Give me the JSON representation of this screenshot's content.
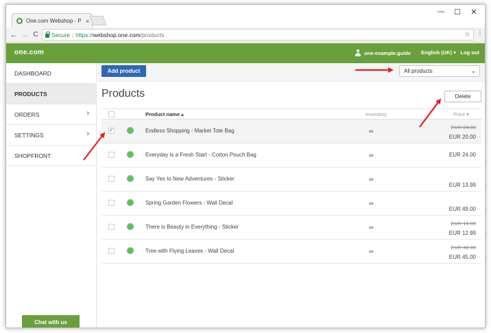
{
  "browser": {
    "tab_title": "One.com Webshop - Pro",
    "tab_close": "×",
    "window_controls": {
      "minimize": "—",
      "maximize": "☐",
      "close": "✕"
    },
    "nav": {
      "back": "←",
      "forward": "→",
      "reload": "C"
    },
    "security_label": "Secure",
    "url_scheme": "https://",
    "url_host": "webshop.one.com",
    "url_path": "/products",
    "bookmark_icon": "star-icon",
    "menu_icon": "⋮"
  },
  "header": {
    "logo": "one.com",
    "user": "one-example.guide",
    "language": "English (UK) ▾",
    "logout": "Log out",
    "brand_color": "#6aa03c"
  },
  "sidebar": {
    "items": [
      {
        "label": "DASHBOARD",
        "active": false,
        "chevron": false
      },
      {
        "label": "PRODUCTS",
        "active": true,
        "chevron": false
      },
      {
        "label": "ORDERS",
        "active": false,
        "chevron": true
      },
      {
        "label": "SETTINGS",
        "active": false,
        "chevron": true
      },
      {
        "label": "SHOPFRONT",
        "active": false,
        "chevron": false
      }
    ],
    "chat_label": "Chat with us"
  },
  "main": {
    "add_label": "Add product",
    "filter_value": "All products",
    "title": "Products",
    "delete_label": "Delete",
    "columns": {
      "name": "Product name ▴",
      "inventory": "Inventory",
      "price": "Price ▾"
    },
    "rows": [
      {
        "name": "Endless Shopping - Market Tote Bag",
        "inventory": "∞",
        "old_price": "EUR 24.00",
        "price": "EUR 20.00",
        "checked": true,
        "status_color": "#5cc45c"
      },
      {
        "name": "Everyday is a Fresh Start - Cotton Pouch Bag",
        "inventory": "∞",
        "old_price": "",
        "price": "EUR 24.00",
        "checked": false,
        "status_color": "#5cc45c"
      },
      {
        "name": "Say Yes to New Adventures - Sticker",
        "inventory": "∞",
        "old_price": "",
        "price": "EUR 13.99",
        "checked": false,
        "status_color": "#5cc45c"
      },
      {
        "name": "Spring Garden Flowers - Wall Decal",
        "inventory": "∞",
        "old_price": "",
        "price": "EUR 49.00",
        "checked": false,
        "status_color": "#5cc45c"
      },
      {
        "name": "There is Beauty in Everything - Sticker",
        "inventory": "∞",
        "old_price": "EUR 15.00",
        "price": "EUR 12.99",
        "checked": false,
        "status_color": "#5cc45c"
      },
      {
        "name": "Tree with Flying Leaves - Wall Decal",
        "inventory": "∞",
        "old_price": "EUR 49.00",
        "price": "EUR 45.00",
        "checked": false,
        "status_color": "#5cc45c"
      }
    ]
  },
  "annotation_color": "#e02020"
}
